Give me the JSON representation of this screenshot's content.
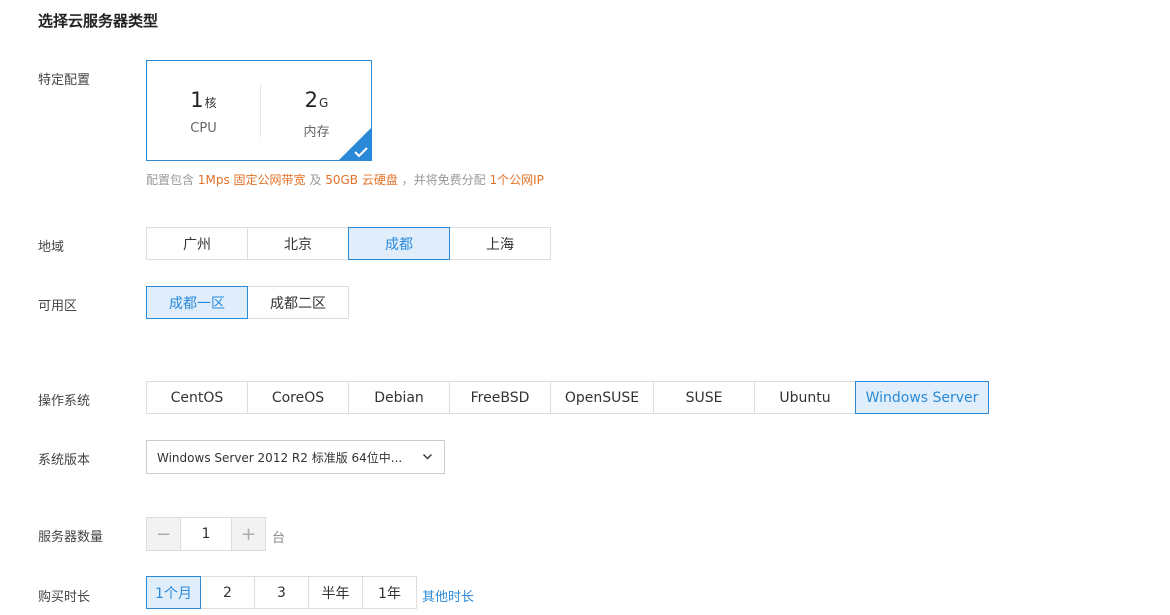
{
  "page_title": "选择云服务器类型",
  "spec": {
    "label": "特定配置",
    "cpu_value": "1",
    "cpu_unit": "核",
    "cpu_caption": "CPU",
    "mem_value": "2",
    "mem_unit": "G",
    "mem_caption": "内存",
    "selected": true
  },
  "note": {
    "t1": "配置包含",
    "bandwidth": "1Mps 固定公网带宽",
    "t2": "及",
    "disk": "50GB 云硬盘",
    "t3": "，并将免费分配",
    "ip": "1个公网IP"
  },
  "region": {
    "label": "地域",
    "options": [
      "广州",
      "北京",
      "成都",
      "上海"
    ],
    "selected": "成都"
  },
  "zone": {
    "label": "可用区",
    "options": [
      "成都一区",
      "成都二区"
    ],
    "selected": "成都一区"
  },
  "os": {
    "label": "操作系统",
    "options": [
      "CentOS",
      "CoreOS",
      "Debian",
      "FreeBSD",
      "OpenSUSE",
      "SUSE",
      "Ubuntu",
      "Windows Server"
    ],
    "selected": "Windows Server"
  },
  "os_version": {
    "label": "系统版本",
    "value": "Windows Server 2012 R2 标准版 64位中..."
  },
  "server_count": {
    "label": "服务器数量",
    "minus": "−",
    "plus": "+",
    "value": "1",
    "unit": "台"
  },
  "duration": {
    "label": "购买时长",
    "options": [
      "1个月",
      "2",
      "3",
      "半年",
      "1年"
    ],
    "selected": "1个月",
    "other_link": "其他时长"
  },
  "colors": {
    "accent": "#2b8ad8",
    "accent_bg": "#e0eefb",
    "highlight": "#e27228"
  }
}
